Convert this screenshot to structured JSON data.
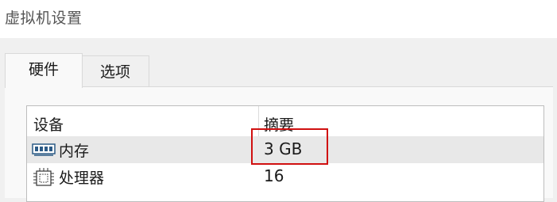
{
  "window": {
    "title": "虚拟机设置"
  },
  "tabs": [
    {
      "label": "硬件",
      "active": true
    },
    {
      "label": "选项",
      "active": false
    }
  ],
  "device_list": {
    "columns": {
      "device": "设备",
      "summary": "摘要"
    },
    "rows": [
      {
        "icon": "memory-icon",
        "device": "内存",
        "summary": "3 GB",
        "selected": true
      },
      {
        "icon": "processor-icon",
        "device": "处理器",
        "summary": "16",
        "selected": false
      }
    ]
  },
  "annotation": {
    "highlight_color": "#d01010"
  }
}
